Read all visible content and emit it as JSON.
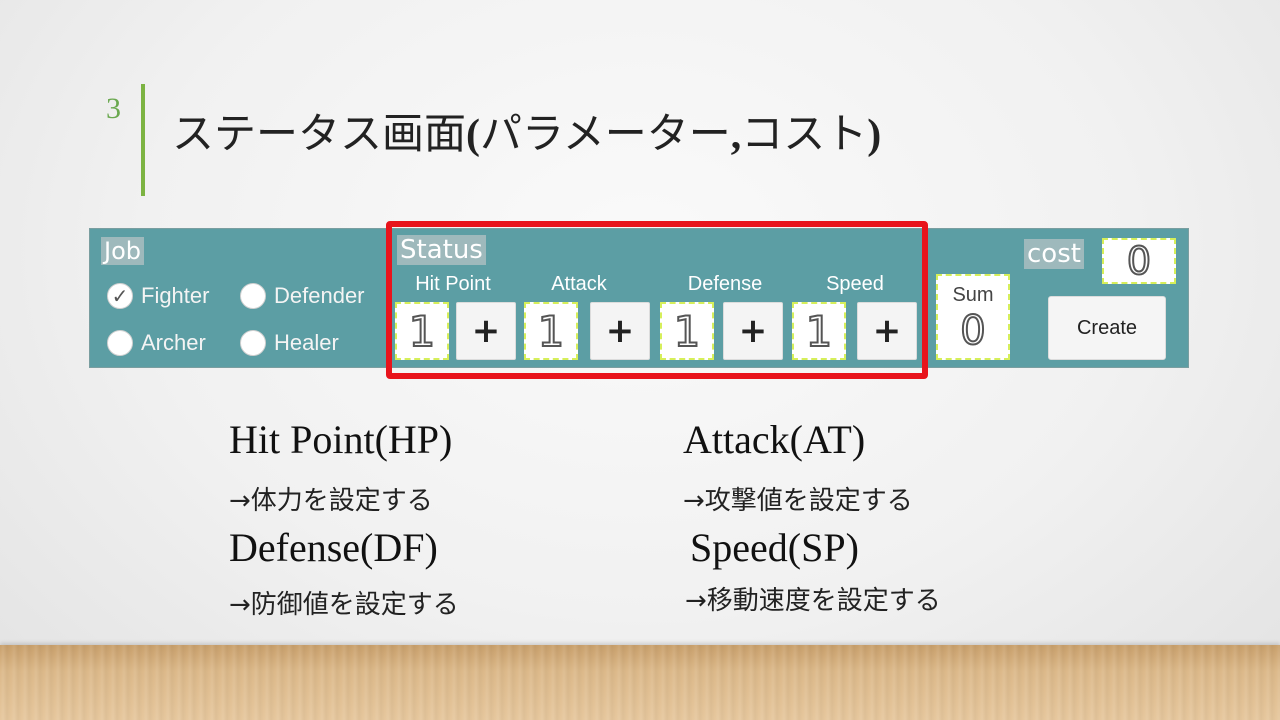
{
  "slide": {
    "number": "3",
    "title_main": "ステータス画面",
    "title_paren": "(",
    "title_inner": "パラメーター",
    "title_comma": ",",
    "title_inner2": "コスト",
    "title_close": ")"
  },
  "panel": {
    "job_label": "Job",
    "jobs": [
      {
        "label": "Fighter",
        "checked": true
      },
      {
        "label": "Defender",
        "checked": false
      },
      {
        "label": "Archer",
        "checked": false
      },
      {
        "label": "Healer",
        "checked": false
      }
    ],
    "check_glyph": "✓",
    "status_label": "Status",
    "stats": [
      {
        "label": "Hit Point",
        "value": "1"
      },
      {
        "label": "Attack",
        "value": "1"
      },
      {
        "label": "Defense",
        "value": "1"
      },
      {
        "label": "Speed",
        "value": "1"
      }
    ],
    "plus_label": "+",
    "sum_label": "Sum",
    "sum_value": "0",
    "cost_label": "cost",
    "cost_value": "0",
    "create_label": "Create"
  },
  "descriptions": [
    {
      "title": "Hit Point(HP)",
      "text": "→体力を設定する"
    },
    {
      "title": "Attack(AT)",
      "text": "→攻撃値を設定する"
    },
    {
      "title": "Defense(DF)",
      "text": "→防御値を設定する"
    },
    {
      "title": "Speed(SP)",
      "text": "→移動速度を設定する"
    }
  ],
  "colors": {
    "panel_bg": "#5c9ea4",
    "highlight": "#e8141c",
    "accent_bar": "#7cb342"
  }
}
